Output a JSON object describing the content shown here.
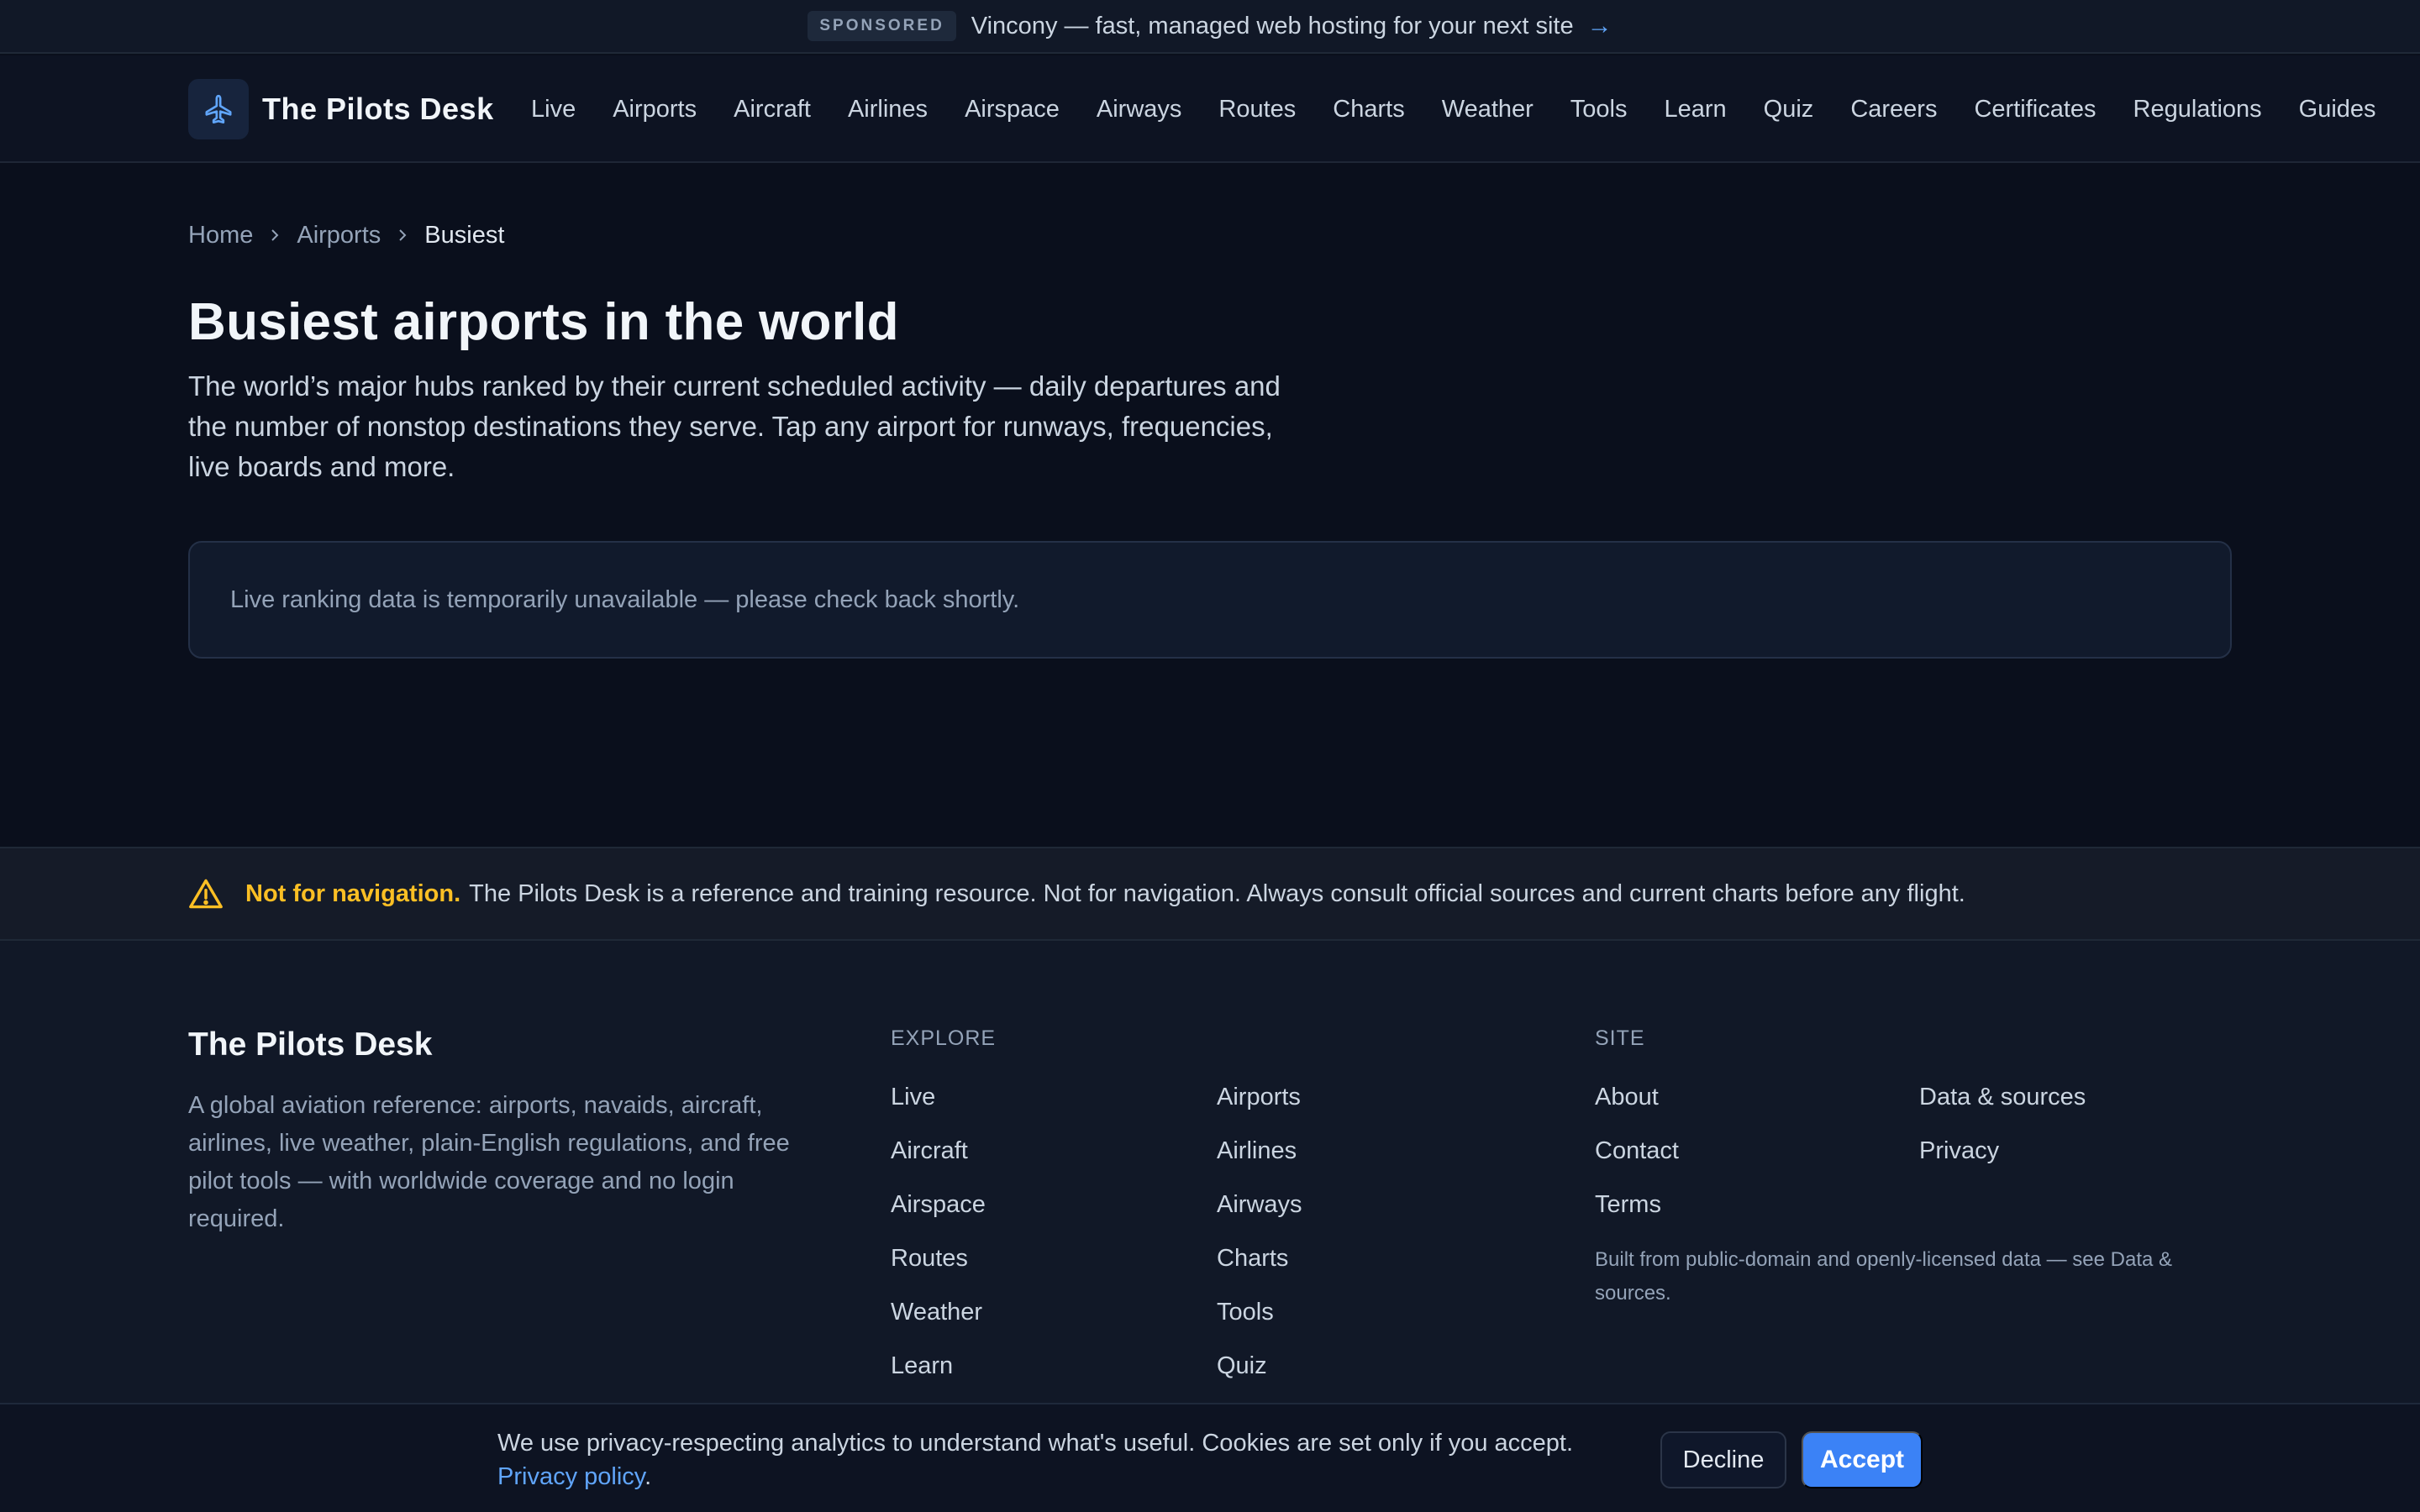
{
  "sponsor": {
    "badge": "SPONSORED",
    "text": "Vincony — fast, managed web hosting for your next site",
    "arrow_icon": "arrow-right-icon"
  },
  "header": {
    "brand_name": "The Pilots Desk",
    "logo_icon": "airplane-icon",
    "nav": [
      "Live",
      "Airports",
      "Aircraft",
      "Airlines",
      "Airspace",
      "Airways",
      "Routes",
      "Charts",
      "Weather",
      "Tools",
      "Learn",
      "Quiz",
      "Careers",
      "Certificates",
      "Regulations",
      "Guides"
    ]
  },
  "breadcrumb": {
    "items": [
      "Home",
      "Airports",
      "Busiest"
    ]
  },
  "main": {
    "title": "Busiest airports in the world",
    "description": "The world’s major hubs ranked by their current scheduled activity — daily departures and the number of nonstop destinations they serve. Tap any airport for runways, frequencies, live boards and more.",
    "notice": "Live ranking data is temporarily unavailable — please check back shortly."
  },
  "disclaimer": {
    "strong": "Not for navigation.",
    "text": "The Pilots Desk is a reference and training resource. Not for navigation. Always consult official sources and current charts before any flight.",
    "icon": "warning-icon"
  },
  "footer": {
    "brand": "The Pilots Desk",
    "about": "A global aviation reference: airports, navaids, aircraft, airlines, live weather, plain-English regulations, and free pilot tools — with worldwide coverage and no login required.",
    "explore_heading": "EXPLORE",
    "explore_links": [
      "Live",
      "Airports",
      "Aircraft",
      "Airlines",
      "Airspace",
      "Airways",
      "Routes",
      "Charts",
      "Weather",
      "Tools",
      "Learn",
      "Quiz"
    ],
    "site_heading": "SITE",
    "site_links": [
      "About",
      "Data & sources",
      "Contact",
      "Privacy",
      "Terms"
    ],
    "note": "Built from public-domain and openly-licensed data — see Data & sources."
  },
  "cookie": {
    "text": "We use privacy-respecting analytics to understand what's useful. Cookies are set only if you accept.",
    "link": "Privacy policy",
    "link_suffix": ".",
    "decline": "Decline",
    "accept": "Accept"
  },
  "colors": {
    "background": "#0a0f1c",
    "accent": "#3b82f6",
    "warning": "#fbbf24"
  }
}
